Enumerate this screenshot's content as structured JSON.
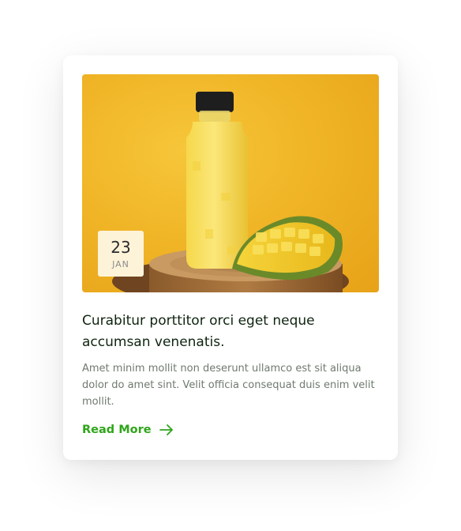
{
  "card": {
    "image": {
      "description_icon": "mango-juice-bottle-photo"
    },
    "date": {
      "day": "23",
      "month": "JAN"
    },
    "title": "Curabitur porttitor orci eget neque accumsan venenatis.",
    "excerpt": "Amet minim mollit non deserunt ullamco est sit aliqua dolor do amet sint. Velit officia consequat duis enim velit mollit.",
    "read_more": {
      "label": "Read More",
      "icon": "arrow-right-icon"
    }
  },
  "colors": {
    "accent": "#2fa51a",
    "title": "#0f2410",
    "body_text": "#6f7a6f",
    "image_background": "#f0b527",
    "badge_background": "#fdf3d9"
  }
}
